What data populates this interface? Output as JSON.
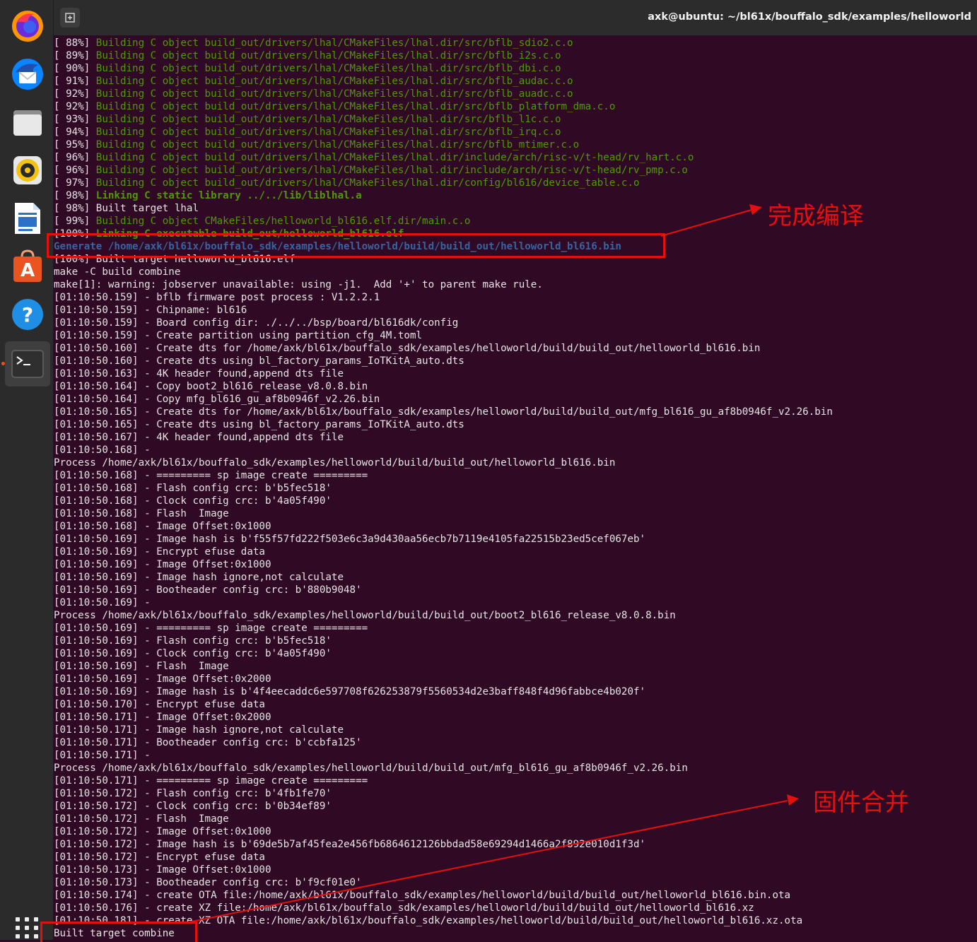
{
  "window": {
    "title": "axk@ubuntu: ~/bl61x/bouffalo_sdk/examples/helloworld"
  },
  "dock": [
    {
      "name": "firefox-icon",
      "color": "#e66000"
    },
    {
      "name": "thunderbird-icon",
      "color": "#0a84ff"
    },
    {
      "name": "files-icon",
      "color": "#c9c9c9"
    },
    {
      "name": "rhythmbox-icon",
      "color": "#f5c211"
    },
    {
      "name": "libreoffice-writer-icon",
      "color": "#2a72c8"
    },
    {
      "name": "ubuntu-software-icon",
      "color": "#e95420"
    },
    {
      "name": "help-icon",
      "color": "#1f8fe5"
    },
    {
      "name": "terminal-icon",
      "color": "#3a3a3a"
    }
  ],
  "annotations": {
    "compile_done": "完成编译",
    "firmware_merge": "固件合并"
  },
  "colors": {
    "terminal_bg": "#300a24",
    "green": "#4e9a06",
    "blue": "#3465a4",
    "annotation_red": "#e41010"
  },
  "terminal_lines": [
    {
      "pre": "[ 88%] ",
      "text": "Building C object build_out/drivers/lhal/CMakeFiles/lhal.dir/src/bflb_sdio2.c.o",
      "style": "g"
    },
    {
      "pre": "[ 89%] ",
      "text": "Building C object build_out/drivers/lhal/CMakeFiles/lhal.dir/src/bflb_i2s.c.o",
      "style": "g"
    },
    {
      "pre": "[ 90%] ",
      "text": "Building C object build_out/drivers/lhal/CMakeFiles/lhal.dir/src/bflb_dbi.c.o",
      "style": "g"
    },
    {
      "pre": "[ 91%] ",
      "text": "Building C object build_out/drivers/lhal/CMakeFiles/lhal.dir/src/bflb_audac.c.o",
      "style": "g"
    },
    {
      "pre": "[ 92%] ",
      "text": "Building C object build_out/drivers/lhal/CMakeFiles/lhal.dir/src/bflb_auadc.c.o",
      "style": "g"
    },
    {
      "pre": "[ 92%] ",
      "text": "Building C object build_out/drivers/lhal/CMakeFiles/lhal.dir/src/bflb_platform_dma.c.o",
      "style": "g"
    },
    {
      "pre": "[ 93%] ",
      "text": "Building C object build_out/drivers/lhal/CMakeFiles/lhal.dir/src/bflb_l1c.c.o",
      "style": "g"
    },
    {
      "pre": "[ 94%] ",
      "text": "Building C object build_out/drivers/lhal/CMakeFiles/lhal.dir/src/bflb_irq.c.o",
      "style": "g"
    },
    {
      "pre": "[ 95%] ",
      "text": "Building C object build_out/drivers/lhal/CMakeFiles/lhal.dir/src/bflb_mtimer.c.o",
      "style": "g"
    },
    {
      "pre": "[ 96%] ",
      "text": "Building C object build_out/drivers/lhal/CMakeFiles/lhal.dir/include/arch/risc-v/t-head/rv_hart.c.o",
      "style": "g"
    },
    {
      "pre": "[ 96%] ",
      "text": "Building C object build_out/drivers/lhal/CMakeFiles/lhal.dir/include/arch/risc-v/t-head/rv_pmp.c.o",
      "style": "g"
    },
    {
      "pre": "[ 97%] ",
      "text": "Building C object build_out/drivers/lhal/CMakeFiles/lhal.dir/config/bl616/device_table.c.o",
      "style": "g"
    },
    {
      "pre": "[ 98%] ",
      "text": "Linking C static library ../../lib/liblhal.a",
      "style": "gb"
    },
    {
      "pre": "[ 98%] ",
      "text": "Built target lhal",
      "style": "w"
    },
    {
      "pre": "[ 99%] ",
      "text": "Building C object CMakeFiles/helloworld_bl616.elf.dir/main.c.o",
      "style": "g"
    },
    {
      "pre": "[100%] ",
      "text": "Linking C executable build_out/helloworld_bl616.elf",
      "style": "gb-strike"
    },
    {
      "pre": "",
      "text": "Generate /home/axk/bl61x/bouffalo_sdk/examples/helloworld/build/build_out/helloworld_bl616.bin",
      "style": "b"
    },
    {
      "pre": "[100%] ",
      "text": "Built target helloworld_bl616.elf",
      "style": "w"
    },
    {
      "pre": "",
      "text": "make -C build combine",
      "style": "w"
    },
    {
      "pre": "",
      "text": "make[1]: warning: jobserver unavailable: using -j1.  Add '+' to parent make rule.",
      "style": "w"
    },
    {
      "pre": "",
      "text": "[01:10:50.159] - bflb firmware post process : V1.2.2.1",
      "style": "w"
    },
    {
      "pre": "",
      "text": "[01:10:50.159] - Chipname: bl616",
      "style": "w"
    },
    {
      "pre": "",
      "text": "[01:10:50.159] - Board config dir: ./../../bsp/board/bl616dk/config",
      "style": "w"
    },
    {
      "pre": "",
      "text": "[01:10:50.159] - Create partition using partition_cfg_4M.toml",
      "style": "w"
    },
    {
      "pre": "",
      "text": "[01:10:50.160] - Create dts for /home/axk/bl61x/bouffalo_sdk/examples/helloworld/build/build_out/helloworld_bl616.bin",
      "style": "w"
    },
    {
      "pre": "",
      "text": "[01:10:50.160] - Create dts using bl_factory_params_IoTKitA_auto.dts",
      "style": "w"
    },
    {
      "pre": "",
      "text": "[01:10:50.163] - 4K header found,append dts file",
      "style": "w"
    },
    {
      "pre": "",
      "text": "[01:10:50.164] - Copy boot2_bl616_release_v8.0.8.bin",
      "style": "w"
    },
    {
      "pre": "",
      "text": "[01:10:50.164] - Copy mfg_bl616_gu_af8b0946f_v2.26.bin",
      "style": "w"
    },
    {
      "pre": "",
      "text": "[01:10:50.165] - Create dts for /home/axk/bl61x/bouffalo_sdk/examples/helloworld/build/build_out/mfg_bl616_gu_af8b0946f_v2.26.bin",
      "style": "w"
    },
    {
      "pre": "",
      "text": "[01:10:50.165] - Create dts using bl_factory_params_IoTKitA_auto.dts",
      "style": "w"
    },
    {
      "pre": "",
      "text": "[01:10:50.167] - 4K header found,append dts file",
      "style": "w"
    },
    {
      "pre": "",
      "text": "[01:10:50.168] -",
      "style": "w"
    },
    {
      "pre": "",
      "text": "Process /home/axk/bl61x/bouffalo_sdk/examples/helloworld/build/build_out/helloworld_bl616.bin",
      "style": "w"
    },
    {
      "pre": "",
      "text": "[01:10:50.168] - ========= sp image create =========",
      "style": "w"
    },
    {
      "pre": "",
      "text": "[01:10:50.168] - Flash config crc: b'b5fec518'",
      "style": "w"
    },
    {
      "pre": "",
      "text": "[01:10:50.168] - Clock config crc: b'4a05f490'",
      "style": "w"
    },
    {
      "pre": "",
      "text": "[01:10:50.168] - Flash  Image",
      "style": "w"
    },
    {
      "pre": "",
      "text": "[01:10:50.168] - Image Offset:0x1000",
      "style": "w"
    },
    {
      "pre": "",
      "text": "[01:10:50.169] - Image hash is b'f55f57fd222f503e6c3a9d430aa56ecb7b7119e4105fa22515b23ed5cef067eb'",
      "style": "w"
    },
    {
      "pre": "",
      "text": "[01:10:50.169] - Encrypt efuse data",
      "style": "w"
    },
    {
      "pre": "",
      "text": "[01:10:50.169] - Image Offset:0x1000",
      "style": "w"
    },
    {
      "pre": "",
      "text": "[01:10:50.169] - Image hash ignore,not calculate",
      "style": "w"
    },
    {
      "pre": "",
      "text": "[01:10:50.169] - Bootheader config crc: b'880b9048'",
      "style": "w"
    },
    {
      "pre": "",
      "text": "[01:10:50.169] -",
      "style": "w"
    },
    {
      "pre": "",
      "text": "Process /home/axk/bl61x/bouffalo_sdk/examples/helloworld/build/build_out/boot2_bl616_release_v8.0.8.bin",
      "style": "w"
    },
    {
      "pre": "",
      "text": "[01:10:50.169] - ========= sp image create =========",
      "style": "w"
    },
    {
      "pre": "",
      "text": "[01:10:50.169] - Flash config crc: b'b5fec518'",
      "style": "w"
    },
    {
      "pre": "",
      "text": "[01:10:50.169] - Clock config crc: b'4a05f490'",
      "style": "w"
    },
    {
      "pre": "",
      "text": "[01:10:50.169] - Flash  Image",
      "style": "w"
    },
    {
      "pre": "",
      "text": "[01:10:50.169] - Image Offset:0x2000",
      "style": "w"
    },
    {
      "pre": "",
      "text": "[01:10:50.169] - Image hash is b'4f4eecaddc6e597708f626253879f5560534d2e3baff848f4d96fabbce4b020f'",
      "style": "w"
    },
    {
      "pre": "",
      "text": "[01:10:50.170] - Encrypt efuse data",
      "style": "w"
    },
    {
      "pre": "",
      "text": "[01:10:50.171] - Image Offset:0x2000",
      "style": "w"
    },
    {
      "pre": "",
      "text": "[01:10:50.171] - Image hash ignore,not calculate",
      "style": "w"
    },
    {
      "pre": "",
      "text": "[01:10:50.171] - Bootheader config crc: b'ccbfa125'",
      "style": "w"
    },
    {
      "pre": "",
      "text": "[01:10:50.171] -",
      "style": "w"
    },
    {
      "pre": "",
      "text": "Process /home/axk/bl61x/bouffalo_sdk/examples/helloworld/build/build_out/mfg_bl616_gu_af8b0946f_v2.26.bin",
      "style": "w"
    },
    {
      "pre": "",
      "text": "[01:10:50.171] - ========= sp image create =========",
      "style": "w"
    },
    {
      "pre": "",
      "text": "[01:10:50.172] - Flash config crc: b'4fb1fe70'",
      "style": "w"
    },
    {
      "pre": "",
      "text": "[01:10:50.172] - Clock config crc: b'0b34ef89'",
      "style": "w"
    },
    {
      "pre": "",
      "text": "[01:10:50.172] - Flash  Image",
      "style": "w"
    },
    {
      "pre": "",
      "text": "[01:10:50.172] - Image Offset:0x1000",
      "style": "w"
    },
    {
      "pre": "",
      "text": "[01:10:50.172] - Image hash is b'69de5b7af45fea2e456fb6864612126bbdad58e69294d1466a2f892e010d1f3d'",
      "style": "w"
    },
    {
      "pre": "",
      "text": "[01:10:50.172] - Encrypt efuse data",
      "style": "w"
    },
    {
      "pre": "",
      "text": "[01:10:50.173] - Image Offset:0x1000",
      "style": "w"
    },
    {
      "pre": "",
      "text": "[01:10:50.173] - Bootheader config crc: b'f9cf01e0'",
      "style": "w"
    },
    {
      "pre": "",
      "text": "[01:10:50.174] - create OTA file:/home/axk/bl61x/bouffalo_sdk/examples/helloworld/build/build_out/helloworld_bl616.bin.ota",
      "style": "w"
    },
    {
      "pre": "",
      "text": "[01:10:50.176] - create XZ file:/home/axk/bl61x/bouffalo_sdk/examples/helloworld/build/build_out/helloworld_bl616.xz",
      "style": "w"
    },
    {
      "pre": "",
      "text": "[01:10:50.181] - create XZ OTA file:/home/axk/bl61x/bouffalo_sdk/examples/helloworld/build/build_out/helloworld_bl616.xz.ota",
      "style": "w"
    },
    {
      "pre": "",
      "text": "Built target combine",
      "style": "w"
    }
  ]
}
